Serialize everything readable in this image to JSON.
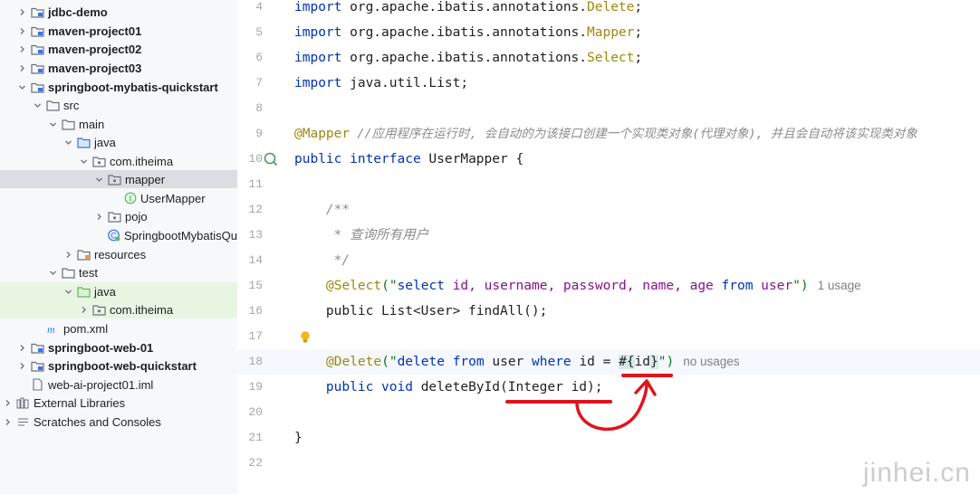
{
  "project_tree": {
    "items": [
      {
        "label": "jdbc-demo"
      },
      {
        "label": "maven-project01"
      },
      {
        "label": "maven-project02"
      },
      {
        "label": "maven-project03"
      },
      {
        "label": "springboot-mybatis-quickstart"
      },
      {
        "label": "src"
      },
      {
        "label": "main"
      },
      {
        "label": "java"
      },
      {
        "label": "com.itheima"
      },
      {
        "label": "mapper"
      },
      {
        "label": "UserMapper"
      },
      {
        "label": "pojo"
      },
      {
        "label": "SpringbootMybatisQu"
      },
      {
        "label": "resources"
      },
      {
        "label": "test"
      },
      {
        "label": "java"
      },
      {
        "label": "com.itheima"
      },
      {
        "label": "pom.xml"
      },
      {
        "label": "springboot-web-01"
      },
      {
        "label": "springboot-web-quickstart"
      },
      {
        "label": "web-ai-project01.iml"
      },
      {
        "label": "External Libraries"
      },
      {
        "label": "Scratches and Consoles"
      }
    ]
  },
  "editor": {
    "line_numbers": [
      "4",
      "5",
      "6",
      "7",
      "8",
      "9",
      "10",
      "11",
      "12",
      "13",
      "14",
      "15",
      "16",
      "17",
      "18",
      "19",
      "20",
      "21",
      "22"
    ],
    "l4": {
      "kw": "import",
      "pkg": " org.apache.ibatis.annotations.",
      "cls": "Delete",
      ";": ";"
    },
    "l5": {
      "kw": "import",
      "pkg": " org.apache.ibatis.annotations.",
      "cls": "Mapper",
      ";": ";"
    },
    "l6": {
      "kw": "import",
      "pkg": " org.apache.ibatis.annotations.",
      "cls": "Select",
      ";": ";"
    },
    "l7": {
      "kw": "import",
      "rest": " java.util.List;"
    },
    "l9": {
      "annotation": "@Mapper",
      "comment": " //应用程序在运行时, 会自动的为该接口创建一个实现类对象(代理对象), 并且会自动将该实现类对象"
    },
    "l10": {
      "kw1": "public",
      "kw2": " interface",
      "rest": " UserMapper {"
    },
    "l12": {
      "comment": "    /**"
    },
    "l13": {
      "comment": "     * 查询所有用户"
    },
    "l14": {
      "comment": "     */"
    },
    "l15": {
      "annotation": "@Select",
      "open": "(\"",
      "sql_select": "select",
      "sql_cols": " id, username, password, name, age ",
      "sql_from": "from",
      "sql_table": " user",
      "close": "\")",
      "hint": "1 usage"
    },
    "l16": {
      "text": "    public List<User> findAll();"
    },
    "l18": {
      "annotation": "@Delete",
      "open": "(\"",
      "sql_delete": "delete",
      "sp1": " ",
      "sql_from": "from",
      "sp2": " user ",
      "sql_where": "where",
      "sp3": " id = ",
      "ph_open": "#{",
      "ph_name": "id",
      "ph_close": "}",
      "close": "\")",
      "hint": "no usages"
    },
    "l19": {
      "kw1": "    public",
      "kw2": " void",
      "name": " deleteById",
      "args": "(Integer id);"
    },
    "l21": {
      "text": "}"
    }
  },
  "watermark": "jinhei.cn",
  "colors": {
    "annotation_red": "#e0141c",
    "keyword": "#0033b3",
    "annotation": "#9e880d",
    "comment": "#8c8c8c",
    "string": "#067d17"
  }
}
